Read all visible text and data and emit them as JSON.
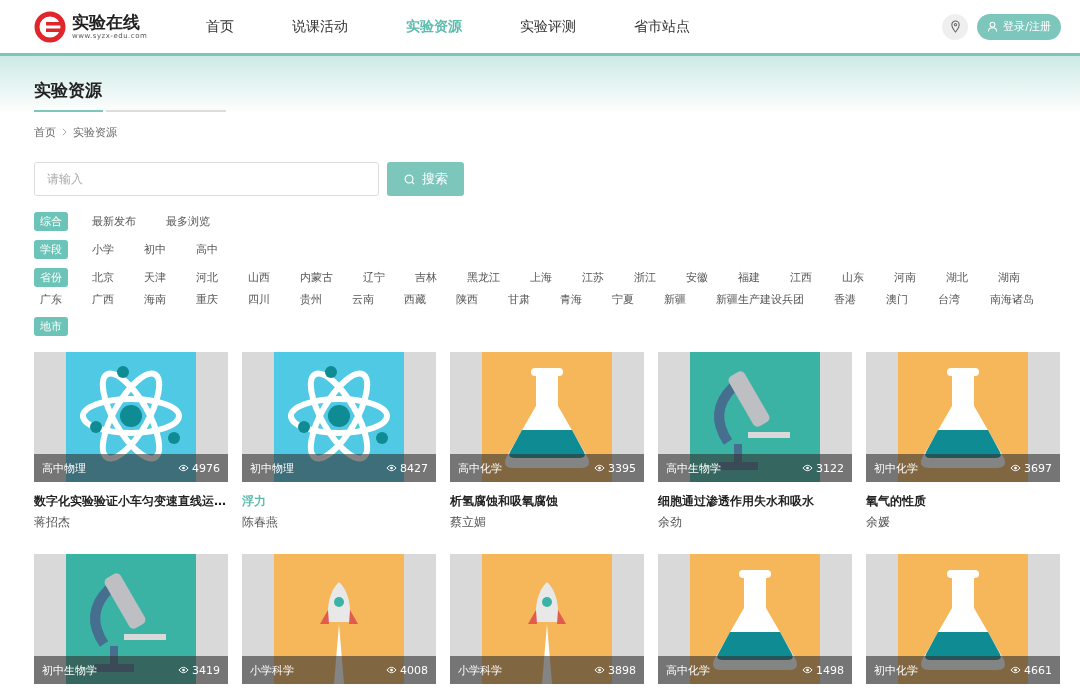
{
  "header": {
    "logo": {
      "name": "实验在线",
      "url": "www.syzx-edu.com"
    },
    "nav": [
      {
        "label": "首页",
        "selected": false
      },
      {
        "label": "说课活动",
        "selected": false
      },
      {
        "label": "实验资源",
        "selected": true
      },
      {
        "label": "实验评测",
        "selected": false
      },
      {
        "label": "省市站点",
        "selected": false
      }
    ],
    "login_button": "登录/注册"
  },
  "page_title": "实验资源",
  "breadcrumb": [
    "首页",
    "实验资源"
  ],
  "search": {
    "placeholder": "请输入",
    "button": "搜索"
  },
  "filters": [
    {
      "label": "综合",
      "options": [
        "最新发布",
        "最多浏览"
      ]
    },
    {
      "label": "学段",
      "options": [
        "小学",
        "初中",
        "高中"
      ]
    },
    {
      "label": "省份",
      "options": [
        "北京",
        "天津",
        "河北",
        "山西",
        "内蒙古",
        "辽宁",
        "吉林",
        "黑龙江",
        "上海",
        "江苏",
        "浙江",
        "安徽",
        "福建",
        "江西",
        "山东",
        "河南",
        "湖北",
        "湖南",
        "广东",
        "广西",
        "海南",
        "重庆",
        "四川",
        "贵州",
        "云南",
        "西藏",
        "陕西",
        "甘肃",
        "青海",
        "宁夏",
        "新疆",
        "新疆生产建设兵团",
        "香港",
        "澳门",
        "台湾",
        "南海诸岛"
      ]
    },
    {
      "label": "地市"
    }
  ],
  "cards": [
    {
      "kind": "atom",
      "subject": "高中物理",
      "views": "4976",
      "title": "数字化实验验证小车匀变速直线运…",
      "author": "蒋招杰",
      "highlighted": false
    },
    {
      "kind": "atom",
      "subject": "初中物理",
      "views": "8427",
      "title": "浮力",
      "author": "陈春燕",
      "highlighted": true
    },
    {
      "kind": "flask",
      "subject": "高中化学",
      "views": "3395",
      "title": "析氢腐蚀和吸氧腐蚀",
      "author": "蔡立媚",
      "highlighted": false
    },
    {
      "kind": "microscope",
      "subject": "高中生物学",
      "views": "3122",
      "title": "细胞通过渗透作用失水和吸水",
      "author": "余劲",
      "highlighted": false
    },
    {
      "kind": "flask",
      "subject": "初中化学",
      "views": "3697",
      "title": "氧气的性质",
      "author": "余媛",
      "highlighted": false
    },
    {
      "kind": "microscope",
      "subject": "初中生物学",
      "views": "3419"
    },
    {
      "kind": "rocket",
      "subject": "小学科学",
      "views": "4008"
    },
    {
      "kind": "rocket",
      "subject": "小学科学",
      "views": "3898"
    },
    {
      "kind": "flask",
      "subject": "高中化学",
      "views": "1498"
    },
    {
      "kind": "flask",
      "subject": "初中化学",
      "views": "4661"
    }
  ]
}
